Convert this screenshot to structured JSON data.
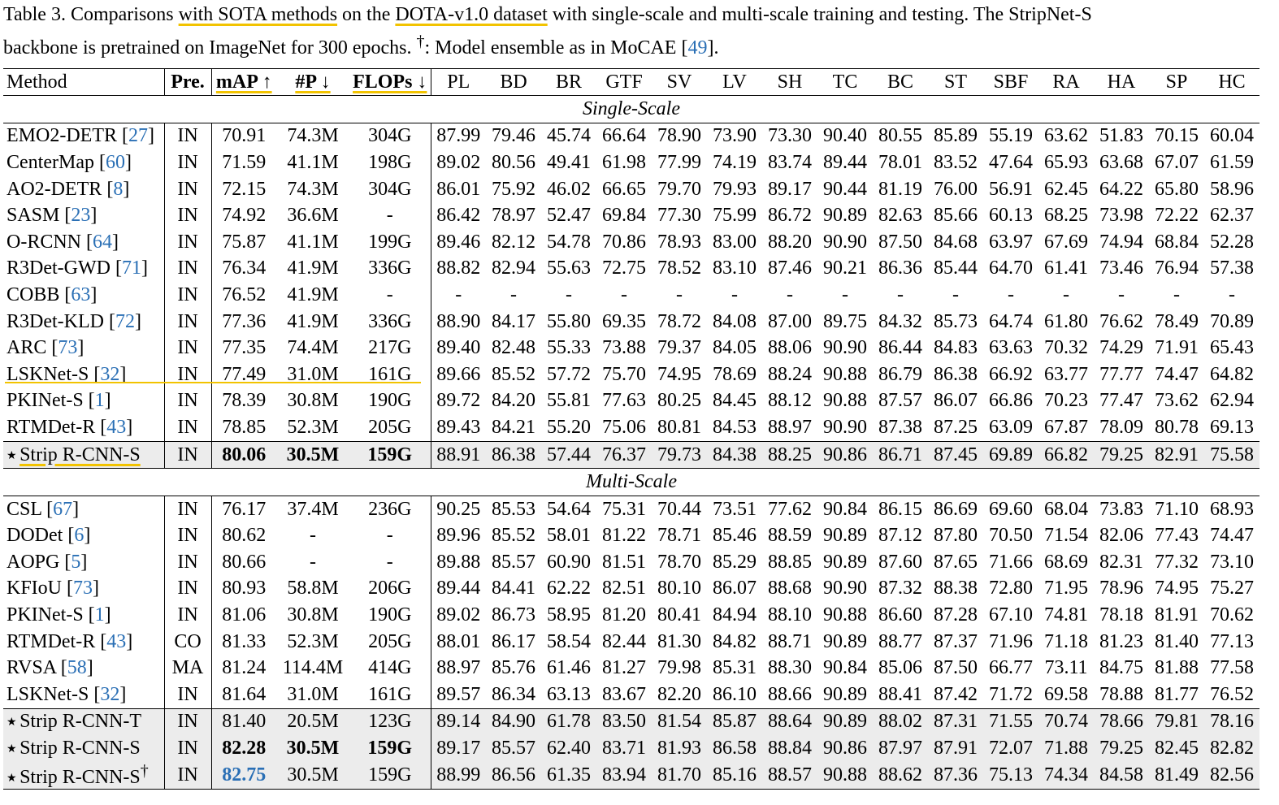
{
  "caption": {
    "prefix": "Table 3. Comparisons ",
    "hl1": "with SOTA methods",
    "mid1": " on the ",
    "hl2": "DOTA-v1.0 dataset",
    "rest1": " with single-scale and multi-scale training and testing. The StripNet-S",
    "line2a": "backbone is pretrained on ImageNet for 300 epochs. ",
    "dagger": "†",
    "line2b": ": Model ensemble as in MoCAE [",
    "ref": "49",
    "line2c": "]."
  },
  "headers": {
    "method": "Method",
    "pre": "Pre.",
    "map": "mAP ↑",
    "params": "#P ↓",
    "flops": "FLOPs ↓",
    "classes": [
      "PL",
      "BD",
      "BR",
      "GTF",
      "SV",
      "LV",
      "SH",
      "TC",
      "BC",
      "ST",
      "SBF",
      "RA",
      "HA",
      "SP",
      "HC"
    ]
  },
  "sections": [
    {
      "label": "Single-Scale",
      "rows": [
        {
          "name": "EMO2-DETR",
          "ref": "27",
          "pre": "IN",
          "map": "70.91",
          "params": "74.3M",
          "flops": "304G",
          "vals": [
            "87.99",
            "79.46",
            "45.74",
            "66.64",
            "78.90",
            "73.90",
            "73.30",
            "90.40",
            "80.55",
            "85.89",
            "55.19",
            "63.62",
            "51.83",
            "70.15",
            "60.04"
          ]
        },
        {
          "name": "CenterMap",
          "ref": "60",
          "pre": "IN",
          "map": "71.59",
          "params": "41.1M",
          "flops": "198G",
          "vals": [
            "89.02",
            "80.56",
            "49.41",
            "61.98",
            "77.99",
            "74.19",
            "83.74",
            "89.44",
            "78.01",
            "83.52",
            "47.64",
            "65.93",
            "63.68",
            "67.07",
            "61.59"
          ]
        },
        {
          "name": "AO2-DETR",
          "ref": "8",
          "pre": "IN",
          "map": "72.15",
          "params": "74.3M",
          "flops": "304G",
          "vals": [
            "86.01",
            "75.92",
            "46.02",
            "66.65",
            "79.70",
            "79.93",
            "89.17",
            "90.44",
            "81.19",
            "76.00",
            "56.91",
            "62.45",
            "64.22",
            "65.80",
            "58.96"
          ]
        },
        {
          "name": "SASM",
          "ref": "23",
          "pre": "IN",
          "map": "74.92",
          "params": "36.6M",
          "flops": "-",
          "vals": [
            "86.42",
            "78.97",
            "52.47",
            "69.84",
            "77.30",
            "75.99",
            "86.72",
            "90.89",
            "82.63",
            "85.66",
            "60.13",
            "68.25",
            "73.98",
            "72.22",
            "62.37"
          ]
        },
        {
          "name": "O-RCNN",
          "ref": "64",
          "pre": "IN",
          "map": "75.87",
          "params": "41.1M",
          "flops": "199G",
          "vals": [
            "89.46",
            "82.12",
            "54.78",
            "70.86",
            "78.93",
            "83.00",
            "88.20",
            "90.90",
            "87.50",
            "84.68",
            "63.97",
            "67.69",
            "74.94",
            "68.84",
            "52.28"
          ]
        },
        {
          "name": "R3Det-GWD",
          "ref": "71",
          "pre": "IN",
          "map": "76.34",
          "params": "41.9M",
          "flops": "336G",
          "vals": [
            "88.82",
            "82.94",
            "55.63",
            "72.75",
            "78.52",
            "83.10",
            "87.46",
            "90.21",
            "86.36",
            "85.44",
            "64.70",
            "61.41",
            "73.46",
            "76.94",
            "57.38"
          ]
        },
        {
          "name": "COBB",
          "ref": "63",
          "pre": "IN",
          "map": "76.52",
          "params": "41.9M",
          "flops": "-",
          "vals": [
            "-",
            "-",
            "-",
            "-",
            "-",
            "-",
            "-",
            "-",
            "-",
            "-",
            "-",
            "-",
            "-",
            "-",
            "-"
          ]
        },
        {
          "name": "R3Det-KLD",
          "ref": "72",
          "pre": "IN",
          "map": "77.36",
          "params": "41.9M",
          "flops": "336G",
          "vals": [
            "88.90",
            "84.17",
            "55.80",
            "69.35",
            "78.72",
            "84.08",
            "87.00",
            "89.75",
            "84.32",
            "85.73",
            "64.74",
            "61.80",
            "76.62",
            "78.49",
            "70.89"
          ]
        },
        {
          "name": "ARC",
          "ref": "73",
          "pre": "IN",
          "map": "77.35",
          "params": "74.4M",
          "flops": "217G",
          "vals": [
            "89.40",
            "82.48",
            "55.33",
            "73.88",
            "79.37",
            "84.05",
            "88.06",
            "90.90",
            "86.44",
            "84.83",
            "63.63",
            "70.32",
            "74.29",
            "71.91",
            "65.43"
          ]
        },
        {
          "name": "LSKNet-S",
          "ref": "32",
          "pre": "IN",
          "map": "77.49",
          "params": "31.0M",
          "flops": "161G",
          "vals": [
            "89.66",
            "85.52",
            "57.72",
            "75.70",
            "74.95",
            "78.69",
            "88.24",
            "90.88",
            "86.79",
            "86.38",
            "66.92",
            "63.77",
            "77.77",
            "74.47",
            "64.82"
          ]
        },
        {
          "name": "PKINet-S",
          "ref": "1",
          "pre": "IN",
          "map": "78.39",
          "params": "30.8M",
          "flops": "190G",
          "vals": [
            "89.72",
            "84.20",
            "55.81",
            "77.63",
            "80.25",
            "84.45",
            "88.12",
            "90.88",
            "87.57",
            "86.07",
            "66.86",
            "70.23",
            "77.47",
            "73.62",
            "62.94"
          ]
        },
        {
          "name": "RTMDet-R",
          "ref": "43",
          "pre": "IN",
          "map": "78.85",
          "params": "52.3M",
          "flops": "205G",
          "vals": [
            "89.43",
            "84.21",
            "55.20",
            "75.06",
            "80.81",
            "84.53",
            "88.97",
            "90.90",
            "87.38",
            "87.25",
            "63.09",
            "67.87",
            "78.09",
            "80.78",
            "69.13"
          ]
        }
      ],
      "ours": [
        {
          "name": "Strip R-CNN-S",
          "pre": "IN",
          "map": "80.06",
          "params": "30.5M",
          "flops": "159G",
          "vals": [
            "88.91",
            "86.38",
            "57.44",
            "76.37",
            "79.73",
            "84.38",
            "88.25",
            "90.86",
            "86.71",
            "87.45",
            "69.89",
            "66.82",
            "79.25",
            "82.91",
            "75.58"
          ]
        }
      ]
    },
    {
      "label": "Multi-Scale",
      "rows": [
        {
          "name": "CSL",
          "ref": "67",
          "pre": "IN",
          "map": "76.17",
          "params": "37.4M",
          "flops": "236G",
          "vals": [
            "90.25",
            "85.53",
            "54.64",
            "75.31",
            "70.44",
            "73.51",
            "77.62",
            "90.84",
            "86.15",
            "86.69",
            "69.60",
            "68.04",
            "73.83",
            "71.10",
            "68.93"
          ]
        },
        {
          "name": "DODet",
          "ref": "6",
          "pre": "IN",
          "map": "80.62",
          "params": "-",
          "flops": "-",
          "vals": [
            "89.96",
            "85.52",
            "58.01",
            "81.22",
            "78.71",
            "85.46",
            "88.59",
            "90.89",
            "87.12",
            "87.80",
            "70.50",
            "71.54",
            "82.06",
            "77.43",
            "74.47"
          ]
        },
        {
          "name": "AOPG",
          "ref": "5",
          "pre": "IN",
          "map": "80.66",
          "params": "-",
          "flops": "-",
          "vals": [
            "89.88",
            "85.57",
            "60.90",
            "81.51",
            "78.70",
            "85.29",
            "88.85",
            "90.89",
            "87.60",
            "87.65",
            "71.66",
            "68.69",
            "82.31",
            "77.32",
            "73.10"
          ]
        },
        {
          "name": "KFIoU",
          "ref": "73",
          "pre": "IN",
          "map": "80.93",
          "params": "58.8M",
          "flops": "206G",
          "vals": [
            "89.44",
            "84.41",
            "62.22",
            "82.51",
            "80.10",
            "86.07",
            "88.68",
            "90.90",
            "87.32",
            "88.38",
            "72.80",
            "71.95",
            "78.96",
            "74.95",
            "75.27"
          ]
        },
        {
          "name": "PKINet-S",
          "ref": "1",
          "pre": "IN",
          "map": "81.06",
          "params": "30.8M",
          "flops": "190G",
          "vals": [
            "89.02",
            "86.73",
            "58.95",
            "81.20",
            "80.41",
            "84.94",
            "88.10",
            "90.88",
            "86.60",
            "87.28",
            "67.10",
            "74.81",
            "78.18",
            "81.91",
            "70.62"
          ]
        },
        {
          "name": "RTMDet-R",
          "ref": "43",
          "pre": "CO",
          "map": "81.33",
          "params": "52.3M",
          "flops": "205G",
          "vals": [
            "88.01",
            "86.17",
            "58.54",
            "82.44",
            "81.30",
            "84.82",
            "88.71",
            "90.89",
            "88.77",
            "87.37",
            "71.96",
            "71.18",
            "81.23",
            "81.40",
            "77.13"
          ]
        },
        {
          "name": "RVSA",
          "ref": "58",
          "pre": "MA",
          "map": "81.24",
          "params": "114.4M",
          "flops": "414G",
          "vals": [
            "88.97",
            "85.76",
            "61.46",
            "81.27",
            "79.98",
            "85.31",
            "88.30",
            "90.84",
            "85.06",
            "87.50",
            "66.77",
            "73.11",
            "84.75",
            "81.88",
            "77.58"
          ]
        },
        {
          "name": "LSKNet-S",
          "ref": "32",
          "pre": "IN",
          "map": "81.64",
          "params": "31.0M",
          "flops": "161G",
          "vals": [
            "89.57",
            "86.34",
            "63.13",
            "83.67",
            "82.20",
            "86.10",
            "88.66",
            "90.89",
            "88.41",
            "87.42",
            "71.72",
            "69.58",
            "78.88",
            "81.77",
            "76.52"
          ]
        }
      ],
      "ours": [
        {
          "name": "Strip R-CNN-T",
          "pre": "IN",
          "map": "81.40",
          "params": "20.5M",
          "flops": "123G",
          "vals": [
            "89.14",
            "84.90",
            "61.78",
            "83.50",
            "81.54",
            "85.87",
            "88.64",
            "90.89",
            "88.02",
            "87.31",
            "71.55",
            "70.74",
            "78.66",
            "79.81",
            "78.16"
          ]
        },
        {
          "name": "Strip R-CNN-S",
          "pre": "IN",
          "map": "82.28",
          "params": "30.5M",
          "flops": "159G",
          "vals": [
            "89.17",
            "85.57",
            "62.40",
            "83.71",
            "81.93",
            "86.58",
            "88.84",
            "90.86",
            "87.97",
            "87.91",
            "72.07",
            "71.88",
            "79.25",
            "82.45",
            "82.82"
          ]
        },
        {
          "name": "Strip R-CNN-S",
          "sup": "†",
          "pre": "IN",
          "map": "82.75",
          "params": "30.5M",
          "flops": "159G",
          "vals": [
            "88.99",
            "86.56",
            "61.35",
            "83.94",
            "81.70",
            "85.16",
            "88.57",
            "90.88",
            "88.62",
            "87.36",
            "75.13",
            "74.34",
            "84.58",
            "81.49",
            "82.56"
          ]
        }
      ]
    }
  ],
  "star_glyph": "★",
  "colors": {
    "highlight": "#f2c300",
    "link": "#2a6fb5",
    "ours_bg": "#ececec"
  }
}
